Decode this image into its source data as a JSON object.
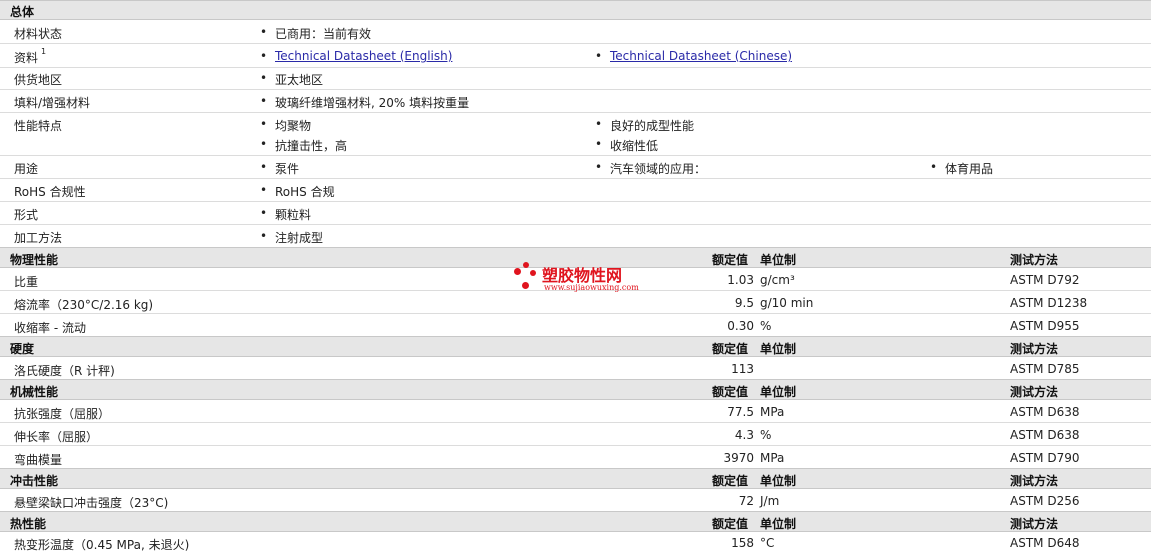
{
  "general": {
    "title": "总体",
    "rows": {
      "status": {
        "label": "材料状态",
        "value": "已商用：当前有效"
      },
      "docs": {
        "label": "资料",
        "sup": "1",
        "link1": "Technical Datasheet (English)",
        "link2": "Technical Datasheet (Chinese)"
      },
      "region": {
        "label": "供货地区",
        "value": "亚太地区"
      },
      "filler": {
        "label": "填料/增强材料",
        "value": "玻璃纤维增强材料, 20% 填料按重量"
      },
      "features": {
        "label": "性能特点",
        "v1": "均聚物",
        "v2": "良好的成型性能",
        "v3": "抗撞击性，高",
        "v4": "收缩性低"
      },
      "uses": {
        "label": "用途",
        "v1": "泵件",
        "v2": "汽车领域的应用：",
        "v3": "体育用品"
      },
      "rohs": {
        "label": "RoHS 合规性",
        "value": "RoHS 合规"
      },
      "form": {
        "label": "形式",
        "value": "颗粒料"
      },
      "process": {
        "label": "加工方法",
        "value": "注射成型"
      }
    }
  },
  "headers": {
    "nominal": "额定值",
    "unit": "单位制",
    "method": "测试方法"
  },
  "physical": {
    "title": "物理性能",
    "rows": [
      {
        "label": "比重",
        "value": "1.03",
        "unit": "g/cm³",
        "method": "ASTM D792"
      },
      {
        "label": "熔流率（230°C/2.16 kg)",
        "value": "9.5",
        "unit": "g/10 min",
        "method": "ASTM D1238"
      },
      {
        "label": "收缩率 - 流动",
        "value": "0.30",
        "unit": "%",
        "method": "ASTM D955"
      }
    ]
  },
  "hardness": {
    "title": "硬度",
    "rows": [
      {
        "label": "洛氏硬度（R 计秤)",
        "value": "113",
        "unit": "",
        "method": "ASTM D785"
      }
    ]
  },
  "mechanical": {
    "title": "机械性能",
    "rows": [
      {
        "label": "抗张强度（屈服）",
        "value": "77.5",
        "unit": "MPa",
        "method": "ASTM D638"
      },
      {
        "label": "伸长率（屈服）",
        "value": "4.3",
        "unit": "%",
        "method": "ASTM D638"
      },
      {
        "label": "弯曲模量",
        "value": "3970",
        "unit": "MPa",
        "method": "ASTM D790"
      }
    ]
  },
  "impact": {
    "title": "冲击性能",
    "rows": [
      {
        "label": "悬壁梁缺口冲击强度（23°C)",
        "value": "72",
        "unit": "J/m",
        "method": "ASTM D256"
      }
    ]
  },
  "thermal": {
    "title": "热性能",
    "rows": [
      {
        "label": "热变形温度（0.45 MPa, 未退火)",
        "value": "158",
        "unit": "°C",
        "method": "ASTM D648"
      }
    ]
  },
  "watermark": {
    "name": "塑胶物性网",
    "url": "www.sujiaowuxing.com"
  }
}
